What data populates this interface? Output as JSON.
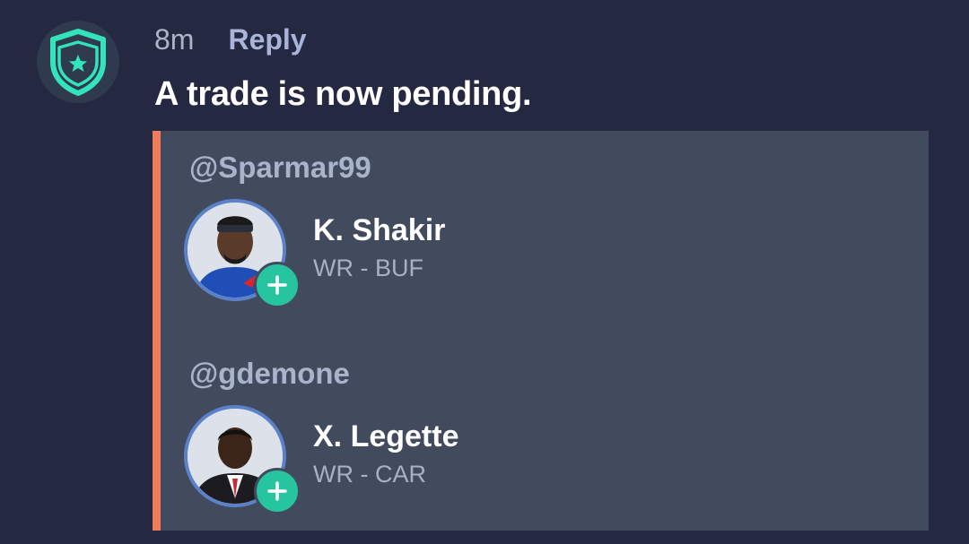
{
  "comment": {
    "time": "8m",
    "reply_label": "Reply",
    "text": "A trade is now pending."
  },
  "trade": {
    "accent_color": "#f07c5c",
    "sides": [
      {
        "handle": "@Sparmar99",
        "player": {
          "name": "K. Shakir",
          "position": "WR - BUF",
          "action_icon": "plus-icon"
        }
      },
      {
        "handle": "@gdemone",
        "player": {
          "name": "X. Legette",
          "position": "WR - CAR",
          "action_icon": "plus-icon"
        }
      }
    ]
  },
  "icons": {
    "avatar": "shield-star-icon",
    "add": "plus-icon"
  },
  "colors": {
    "background": "#252841",
    "card": "#424a5e",
    "add_button": "#26c5a0",
    "shield": "#33e3bb"
  }
}
